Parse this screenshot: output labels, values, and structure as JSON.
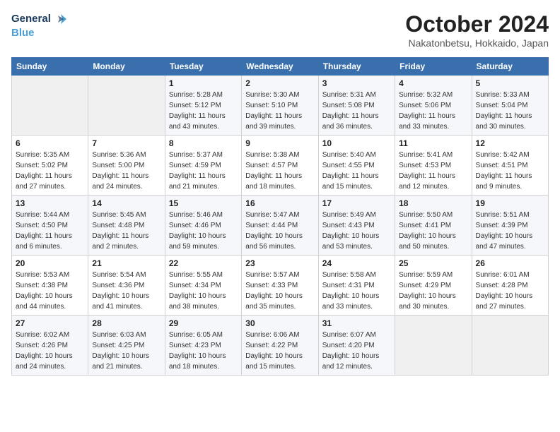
{
  "header": {
    "logo_line1": "General",
    "logo_line2": "Blue",
    "month": "October 2024",
    "location": "Nakatonbetsu, Hokkaido, Japan"
  },
  "days_of_week": [
    "Sunday",
    "Monday",
    "Tuesday",
    "Wednesday",
    "Thursday",
    "Friday",
    "Saturday"
  ],
  "weeks": [
    [
      {
        "day": "",
        "sunrise": "",
        "sunset": "",
        "daylight": ""
      },
      {
        "day": "",
        "sunrise": "",
        "sunset": "",
        "daylight": ""
      },
      {
        "day": "1",
        "sunrise": "Sunrise: 5:28 AM",
        "sunset": "Sunset: 5:12 PM",
        "daylight": "Daylight: 11 hours and 43 minutes."
      },
      {
        "day": "2",
        "sunrise": "Sunrise: 5:30 AM",
        "sunset": "Sunset: 5:10 PM",
        "daylight": "Daylight: 11 hours and 39 minutes."
      },
      {
        "day": "3",
        "sunrise": "Sunrise: 5:31 AM",
        "sunset": "Sunset: 5:08 PM",
        "daylight": "Daylight: 11 hours and 36 minutes."
      },
      {
        "day": "4",
        "sunrise": "Sunrise: 5:32 AM",
        "sunset": "Sunset: 5:06 PM",
        "daylight": "Daylight: 11 hours and 33 minutes."
      },
      {
        "day": "5",
        "sunrise": "Sunrise: 5:33 AM",
        "sunset": "Sunset: 5:04 PM",
        "daylight": "Daylight: 11 hours and 30 minutes."
      }
    ],
    [
      {
        "day": "6",
        "sunrise": "Sunrise: 5:35 AM",
        "sunset": "Sunset: 5:02 PM",
        "daylight": "Daylight: 11 hours and 27 minutes."
      },
      {
        "day": "7",
        "sunrise": "Sunrise: 5:36 AM",
        "sunset": "Sunset: 5:00 PM",
        "daylight": "Daylight: 11 hours and 24 minutes."
      },
      {
        "day": "8",
        "sunrise": "Sunrise: 5:37 AM",
        "sunset": "Sunset: 4:59 PM",
        "daylight": "Daylight: 11 hours and 21 minutes."
      },
      {
        "day": "9",
        "sunrise": "Sunrise: 5:38 AM",
        "sunset": "Sunset: 4:57 PM",
        "daylight": "Daylight: 11 hours and 18 minutes."
      },
      {
        "day": "10",
        "sunrise": "Sunrise: 5:40 AM",
        "sunset": "Sunset: 4:55 PM",
        "daylight": "Daylight: 11 hours and 15 minutes."
      },
      {
        "day": "11",
        "sunrise": "Sunrise: 5:41 AM",
        "sunset": "Sunset: 4:53 PM",
        "daylight": "Daylight: 11 hours and 12 minutes."
      },
      {
        "day": "12",
        "sunrise": "Sunrise: 5:42 AM",
        "sunset": "Sunset: 4:51 PM",
        "daylight": "Daylight: 11 hours and 9 minutes."
      }
    ],
    [
      {
        "day": "13",
        "sunrise": "Sunrise: 5:44 AM",
        "sunset": "Sunset: 4:50 PM",
        "daylight": "Daylight: 11 hours and 6 minutes."
      },
      {
        "day": "14",
        "sunrise": "Sunrise: 5:45 AM",
        "sunset": "Sunset: 4:48 PM",
        "daylight": "Daylight: 11 hours and 2 minutes."
      },
      {
        "day": "15",
        "sunrise": "Sunrise: 5:46 AM",
        "sunset": "Sunset: 4:46 PM",
        "daylight": "Daylight: 10 hours and 59 minutes."
      },
      {
        "day": "16",
        "sunrise": "Sunrise: 5:47 AM",
        "sunset": "Sunset: 4:44 PM",
        "daylight": "Daylight: 10 hours and 56 minutes."
      },
      {
        "day": "17",
        "sunrise": "Sunrise: 5:49 AM",
        "sunset": "Sunset: 4:43 PM",
        "daylight": "Daylight: 10 hours and 53 minutes."
      },
      {
        "day": "18",
        "sunrise": "Sunrise: 5:50 AM",
        "sunset": "Sunset: 4:41 PM",
        "daylight": "Daylight: 10 hours and 50 minutes."
      },
      {
        "day": "19",
        "sunrise": "Sunrise: 5:51 AM",
        "sunset": "Sunset: 4:39 PM",
        "daylight": "Daylight: 10 hours and 47 minutes."
      }
    ],
    [
      {
        "day": "20",
        "sunrise": "Sunrise: 5:53 AM",
        "sunset": "Sunset: 4:38 PM",
        "daylight": "Daylight: 10 hours and 44 minutes."
      },
      {
        "day": "21",
        "sunrise": "Sunrise: 5:54 AM",
        "sunset": "Sunset: 4:36 PM",
        "daylight": "Daylight: 10 hours and 41 minutes."
      },
      {
        "day": "22",
        "sunrise": "Sunrise: 5:55 AM",
        "sunset": "Sunset: 4:34 PM",
        "daylight": "Daylight: 10 hours and 38 minutes."
      },
      {
        "day": "23",
        "sunrise": "Sunrise: 5:57 AM",
        "sunset": "Sunset: 4:33 PM",
        "daylight": "Daylight: 10 hours and 35 minutes."
      },
      {
        "day": "24",
        "sunrise": "Sunrise: 5:58 AM",
        "sunset": "Sunset: 4:31 PM",
        "daylight": "Daylight: 10 hours and 33 minutes."
      },
      {
        "day": "25",
        "sunrise": "Sunrise: 5:59 AM",
        "sunset": "Sunset: 4:29 PM",
        "daylight": "Daylight: 10 hours and 30 minutes."
      },
      {
        "day": "26",
        "sunrise": "Sunrise: 6:01 AM",
        "sunset": "Sunset: 4:28 PM",
        "daylight": "Daylight: 10 hours and 27 minutes."
      }
    ],
    [
      {
        "day": "27",
        "sunrise": "Sunrise: 6:02 AM",
        "sunset": "Sunset: 4:26 PM",
        "daylight": "Daylight: 10 hours and 24 minutes."
      },
      {
        "day": "28",
        "sunrise": "Sunrise: 6:03 AM",
        "sunset": "Sunset: 4:25 PM",
        "daylight": "Daylight: 10 hours and 21 minutes."
      },
      {
        "day": "29",
        "sunrise": "Sunrise: 6:05 AM",
        "sunset": "Sunset: 4:23 PM",
        "daylight": "Daylight: 10 hours and 18 minutes."
      },
      {
        "day": "30",
        "sunrise": "Sunrise: 6:06 AM",
        "sunset": "Sunset: 4:22 PM",
        "daylight": "Daylight: 10 hours and 15 minutes."
      },
      {
        "day": "31",
        "sunrise": "Sunrise: 6:07 AM",
        "sunset": "Sunset: 4:20 PM",
        "daylight": "Daylight: 10 hours and 12 minutes."
      },
      {
        "day": "",
        "sunrise": "",
        "sunset": "",
        "daylight": ""
      },
      {
        "day": "",
        "sunrise": "",
        "sunset": "",
        "daylight": ""
      }
    ]
  ]
}
